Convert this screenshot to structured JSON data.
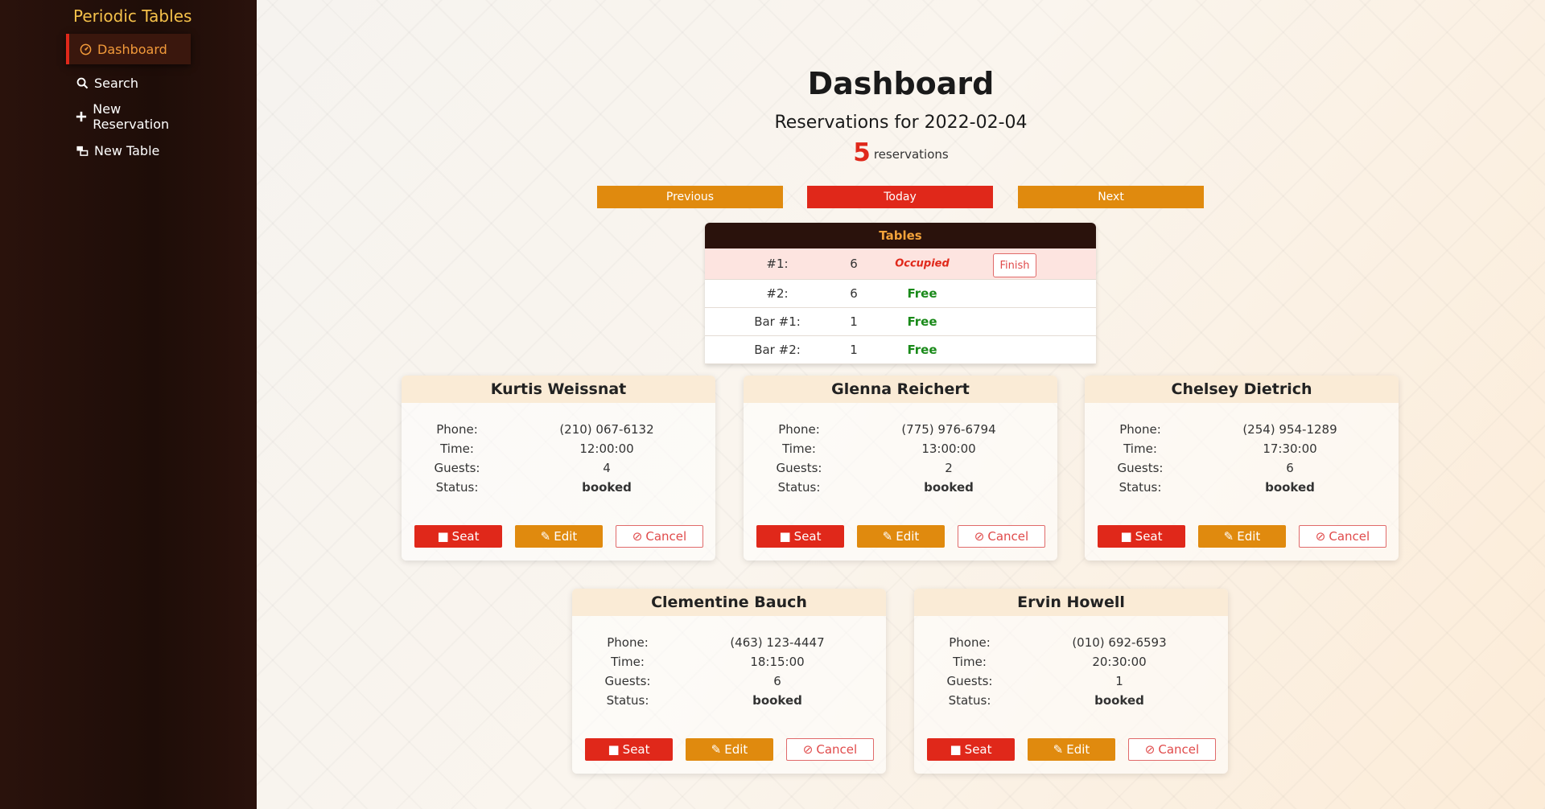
{
  "sidebar": {
    "brand": "Periodic Tables",
    "items": [
      {
        "label": "Dashboard",
        "icon": "dashboard-icon"
      },
      {
        "label": "Search",
        "icon": "search-icon"
      },
      {
        "label": "New Reservation",
        "icon": "plus-icon"
      },
      {
        "label": "New Table",
        "icon": "tables-icon"
      }
    ]
  },
  "header": {
    "title": "Dashboard",
    "subtitle": "Reservations for 2022-02-04",
    "count": "5",
    "count_label": "reservations"
  },
  "date_nav": {
    "previous": "Previous",
    "today": "Today",
    "next": "Next"
  },
  "tables": {
    "heading": "Tables",
    "rows": [
      {
        "name": "#1:",
        "capacity": "6",
        "status": "Occupied",
        "action": "Finish"
      },
      {
        "name": "#2:",
        "capacity": "6",
        "status": "Free"
      },
      {
        "name": "Bar #1:",
        "capacity": "1",
        "status": "Free"
      },
      {
        "name": "Bar #2:",
        "capacity": "1",
        "status": "Free"
      }
    ]
  },
  "labels": {
    "phone": "Phone:",
    "time": "Time:",
    "guests": "Guests:",
    "status": "Status:"
  },
  "buttons": {
    "seat": "Seat",
    "edit": "Edit",
    "cancel": "Cancel"
  },
  "reservations": [
    {
      "name": "Kurtis Weissnat",
      "phone": "(210) 067-6132",
      "time": "12:00:00",
      "guests": "4",
      "status": "booked"
    },
    {
      "name": "Glenna Reichert",
      "phone": "(775) 976-6794",
      "time": "13:00:00",
      "guests": "2",
      "status": "booked"
    },
    {
      "name": "Chelsey Dietrich",
      "phone": "(254) 954-1289",
      "time": "17:30:00",
      "guests": "6",
      "status": "booked"
    },
    {
      "name": "Clementine Bauch",
      "phone": "(463) 123-4447",
      "time": "18:15:00",
      "guests": "6",
      "status": "booked"
    },
    {
      "name": "Ervin Howell",
      "phone": "(010) 692-6593",
      "time": "20:30:00",
      "guests": "1",
      "status": "booked"
    }
  ],
  "colors": {
    "accent": "#e0281a",
    "secondary": "#e08a0e",
    "sidebar": "#1e0d08",
    "brand": "#f5c14a",
    "free": "#1a8a1a"
  }
}
